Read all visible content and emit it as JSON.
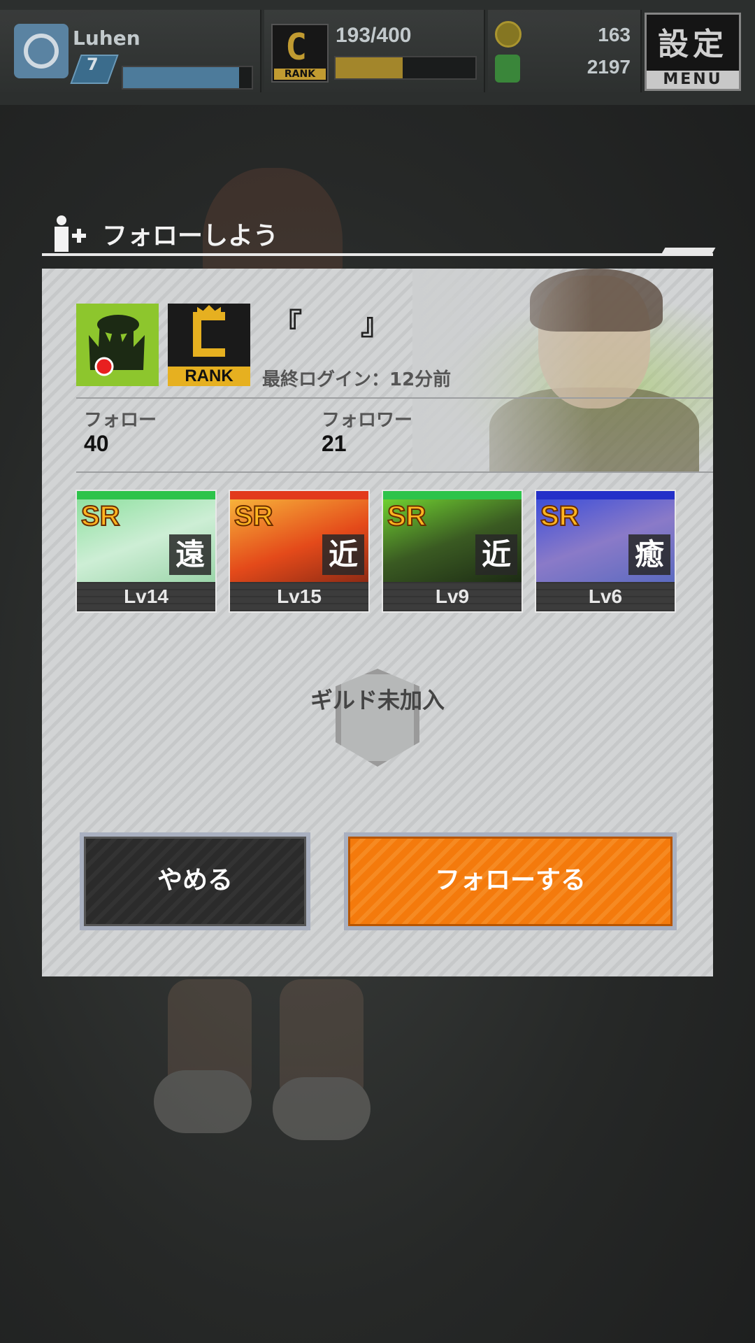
{
  "header": {
    "username": "Luhen",
    "level": "7",
    "exp_fraction": 0.9,
    "rank_letter": "C",
    "rank_word": "RANK",
    "stamina": "193/400",
    "stamina_fraction": 0.48,
    "coins": "163",
    "gems": "2197",
    "menu_kanji": "設定",
    "menu_label": "MENU"
  },
  "dialog": {
    "title": "フォローしよう",
    "player_name": "『　　』",
    "rank_letter": "C",
    "rank_word": "RANK",
    "last_login": "最終ログイン：12分前",
    "follow_label": "フォロー",
    "follow_count": "40",
    "follower_label": "フォロワー",
    "follower_count": "21",
    "cards": [
      {
        "rarity": "SR",
        "role": "遠",
        "level": "Lv14",
        "color": "#2dc34a"
      },
      {
        "rarity": "SR",
        "role": "近",
        "level": "Lv15",
        "color": "#e23a1c"
      },
      {
        "rarity": "SR",
        "role": "近",
        "level": "Lv9",
        "color": "#2dc34a"
      },
      {
        "rarity": "SR",
        "role": "癒",
        "level": "Lv6",
        "color": "#2430c8"
      }
    ],
    "guild_status": "ギルド未加入",
    "cancel_label": "やめる",
    "follow_button_label": "フォローする"
  },
  "colors": {
    "accent_orange": "#f47a0c",
    "guild_green": "#8dc62d",
    "rank_gold": "#e6b020"
  }
}
